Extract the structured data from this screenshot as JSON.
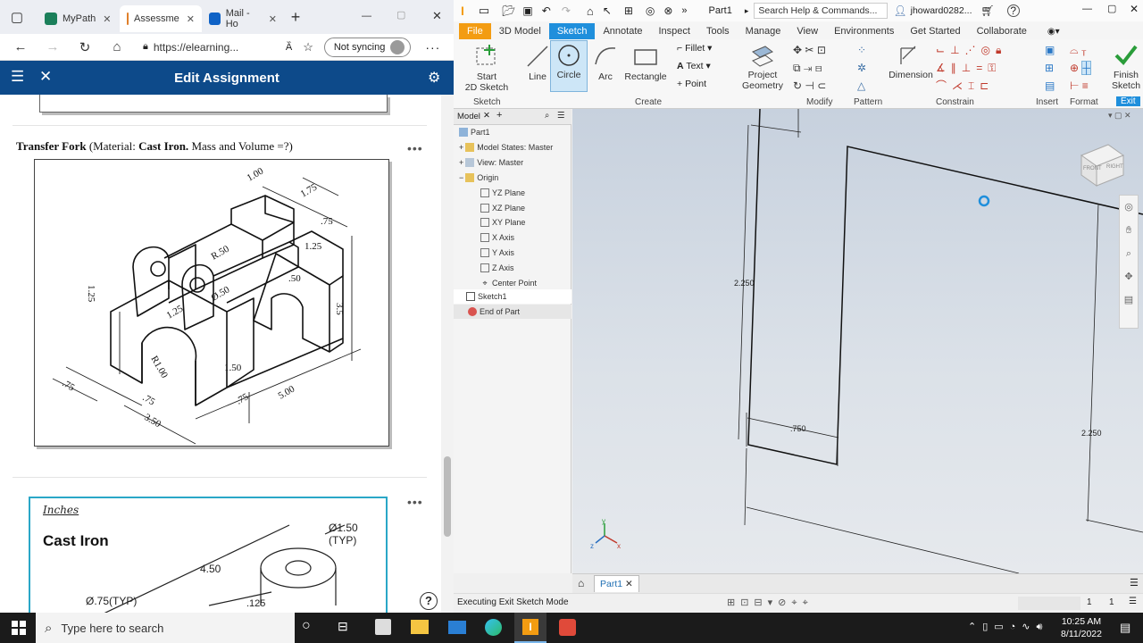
{
  "browser": {
    "tabs": [
      {
        "label": "MyPath",
        "icon": "mypath-icon",
        "color": "#1b7f5a"
      },
      {
        "label": "Assessme",
        "icon": "assessment-icon",
        "color": "#e0802b"
      },
      {
        "label": "Mail - Ho",
        "icon": "outlook-icon",
        "color": "#0f62c6"
      }
    ],
    "url": "https://elearning...",
    "sync_label": "Not syncing"
  },
  "app_header": {
    "title": "Edit Assignment",
    "color": "#0d4a8a"
  },
  "question1": {
    "title_prefix": "Transfer Fork",
    "title_mid": " (Material: ",
    "material": "Cast Iron.",
    "title_suffix": " Mass and Volume =?)",
    "dims": [
      "1.00",
      ".75",
      ".75",
      "R.50",
      "1.25",
      "1.25",
      "Ø.50",
      ".50",
      "3.5",
      "1.25",
      "R1.00",
      "1.50",
      ".75",
      ".75",
      "3.50",
      ".75",
      "5.00"
    ]
  },
  "question2": {
    "units": "Inches",
    "material": "Cast Iron",
    "dims": [
      "Ø1.50 (TYP)",
      "4.50",
      "Ø.75(TYP)",
      ".125"
    ]
  },
  "inventor": {
    "doc_title": "Part1",
    "search_placeholder": "Search Help & Commands...",
    "user": "jhoward0282...",
    "menu_tabs": [
      "File",
      "3D Model",
      "Sketch",
      "Annotate",
      "Inspect",
      "Tools",
      "Manage",
      "View",
      "Environments",
      "Get Started",
      "Collaborate"
    ],
    "active_tab": "Sketch",
    "ribbon": {
      "start_sketch": "Start\n2D Sketch",
      "line": "Line",
      "circle": "Circle",
      "arc": "Arc",
      "rectangle": "Rectangle",
      "fillet": "Fillet",
      "text": "Text",
      "point": "Point",
      "project_geometry": "Project\nGeometry",
      "dimension": "Dimension",
      "finish_sketch": "Finish\nSketch",
      "groups": [
        "Sketch",
        "Create",
        "Modify",
        "Pattern",
        "Constrain",
        "Insert",
        "Format",
        "Exit"
      ]
    },
    "model_panel": {
      "tab": "Model",
      "items": [
        "Part1",
        "Model States: Master",
        "View: Master",
        "Origin",
        "YZ Plane",
        "XZ Plane",
        "XY Plane",
        "X Axis",
        "Y Axis",
        "Z Axis",
        "Center Point",
        "Sketch1",
        "End of Part"
      ]
    },
    "dims": [
      "2.250",
      ".750",
      "2.250"
    ],
    "viewcube": [
      "FRONT",
      "RIGHT"
    ],
    "doc_tab": "Part1",
    "status": "Executing Exit Sketch Mode",
    "status_nums": [
      "1",
      "1"
    ]
  },
  "taskbar": {
    "search_placeholder": "Type here to search",
    "time": "10:25 AM",
    "date": "8/11/2022"
  }
}
